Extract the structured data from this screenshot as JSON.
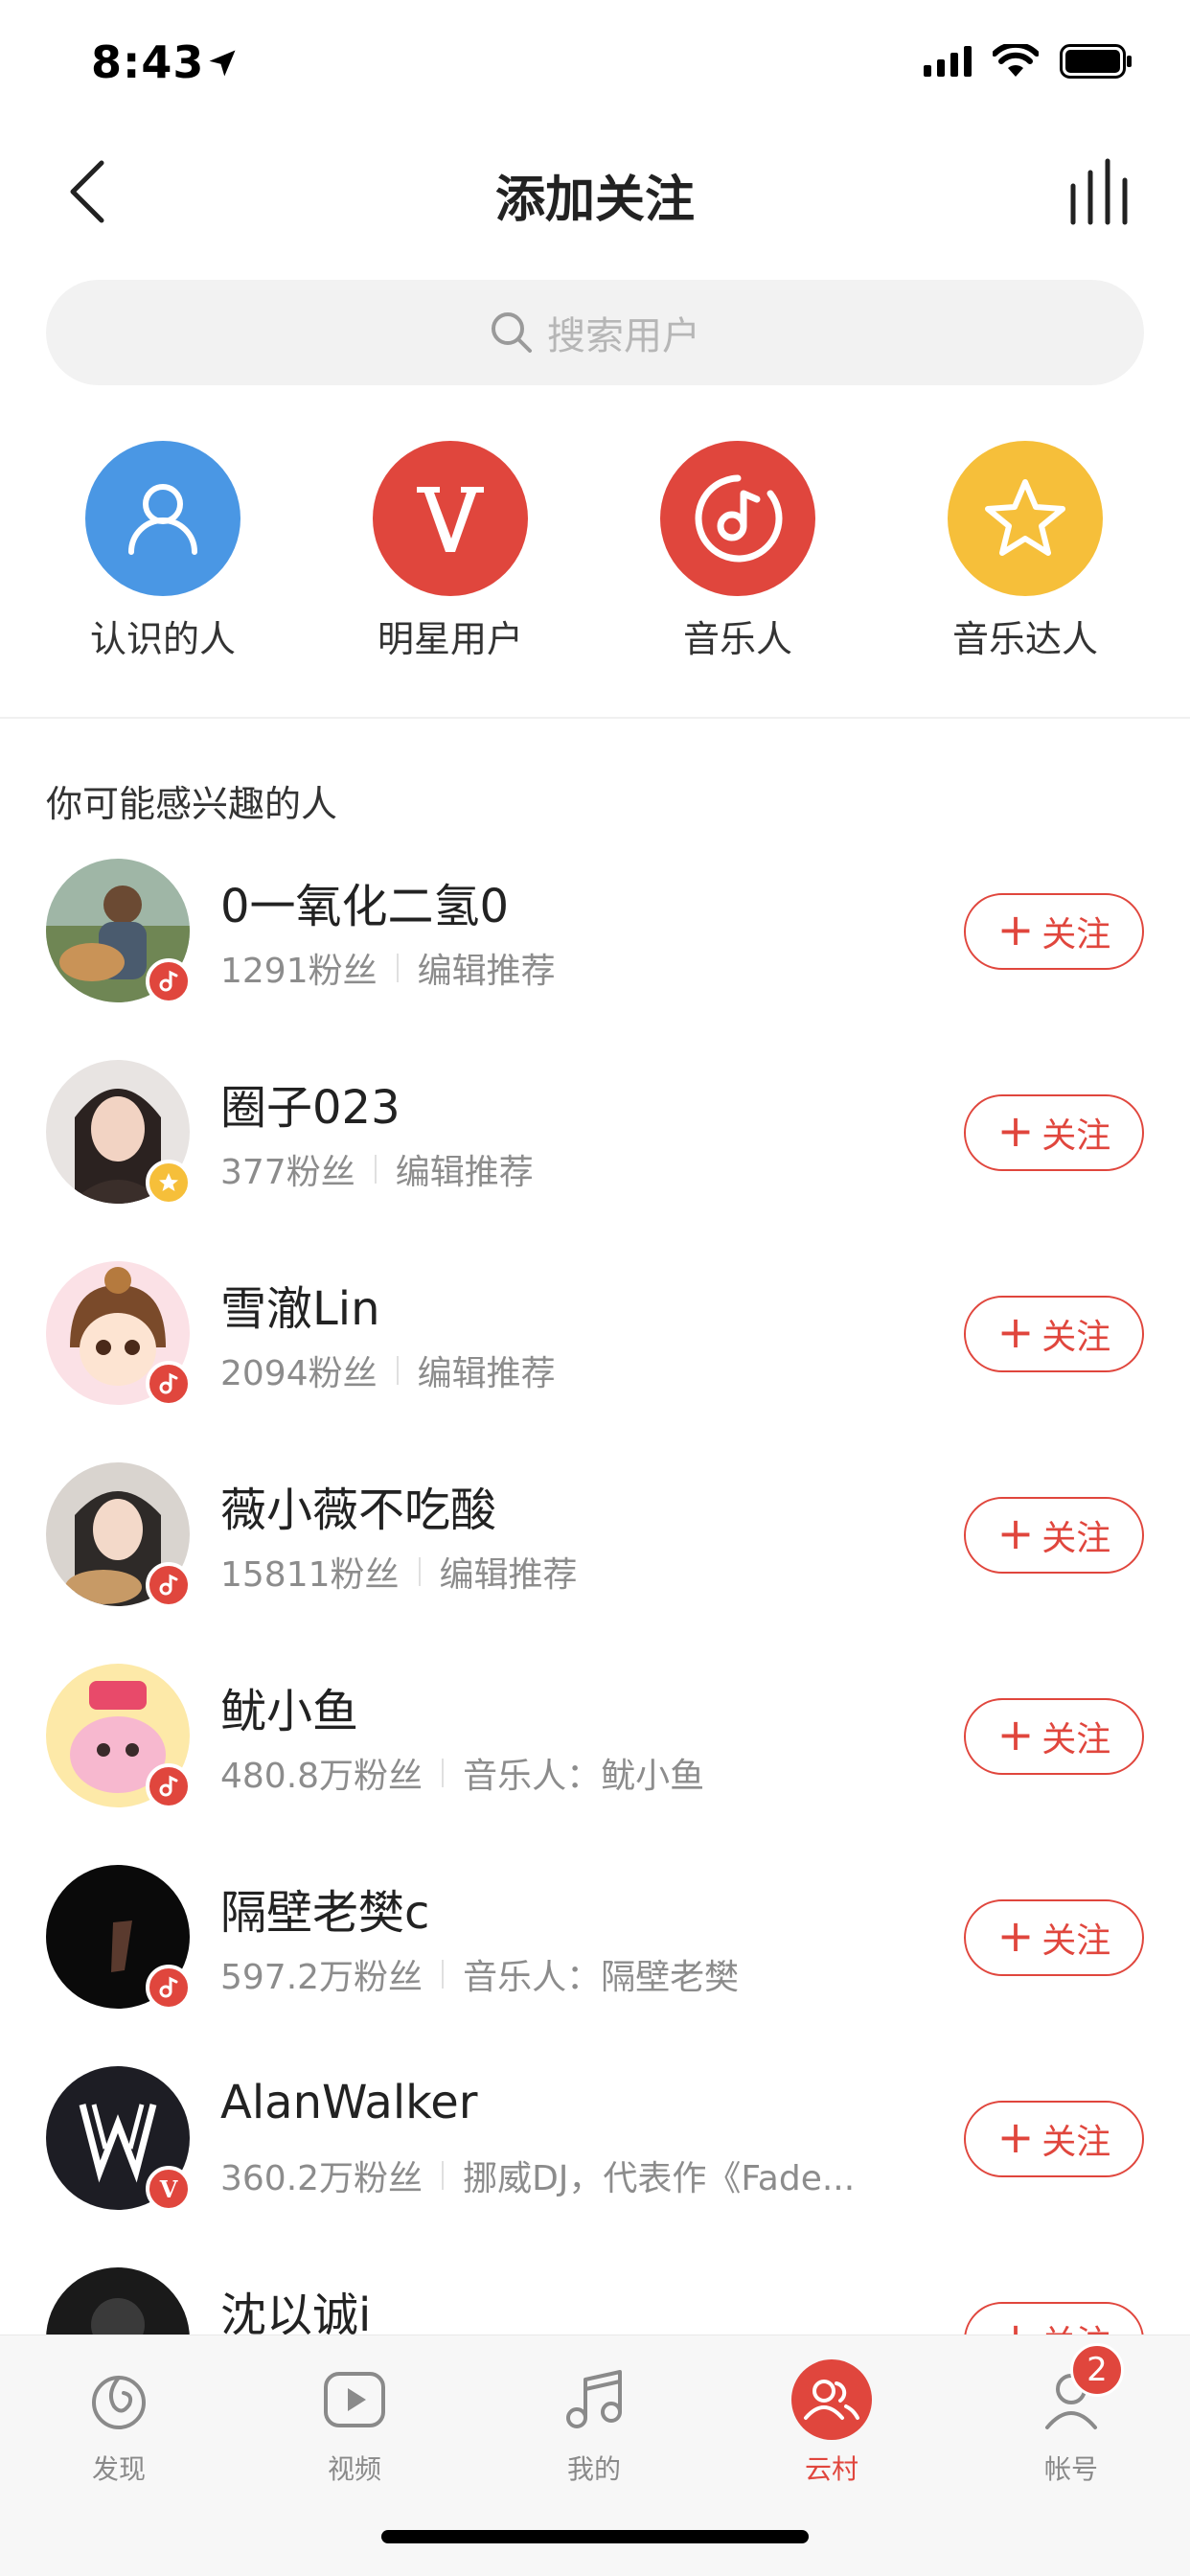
{
  "status_bar": {
    "time": "8:43"
  },
  "header": {
    "title": "添加关注"
  },
  "search": {
    "placeholder": "搜索用户"
  },
  "categories": [
    {
      "label": "认识的人",
      "color": "#4a97e4",
      "icon": "person-icon"
    },
    {
      "label": "明星用户",
      "color": "#e0463d",
      "icon": "v-icon"
    },
    {
      "label": "音乐人",
      "color": "#e0463d",
      "icon": "music-note-icon"
    },
    {
      "label": "音乐达人",
      "color": "#f6bf3a",
      "icon": "star-icon"
    }
  ],
  "section_title": "你可能感兴趣的人",
  "follow_label": "关注",
  "users": [
    {
      "name": "0一氧化二氢0",
      "fans": "1291粉丝",
      "desc": "编辑推荐",
      "badge": "music"
    },
    {
      "name": "圈子023",
      "fans": "377粉丝",
      "desc": "编辑推荐",
      "badge": "star"
    },
    {
      "name": "雪澈Lin",
      "fans": "2094粉丝",
      "desc": "编辑推荐",
      "badge": "music"
    },
    {
      "name": "薇小薇不吃酸",
      "fans": "15811粉丝",
      "desc": "编辑推荐",
      "badge": "music"
    },
    {
      "name": "鱿小鱼",
      "fans": "480.8万粉丝",
      "desc": "音乐人：鱿小鱼",
      "badge": "music"
    },
    {
      "name": "隔壁老樊c",
      "fans": "597.2万粉丝",
      "desc": "音乐人：隔壁老樊",
      "badge": "music"
    },
    {
      "name": "AlanWalker",
      "fans": "360.2万粉丝",
      "desc": "挪威DJ，代表作《Fade...",
      "badge": "v"
    },
    {
      "name": "沈以诚i",
      "fans": "",
      "desc": "",
      "badge": ""
    }
  ],
  "avatar_badge_v": "V",
  "tabs": [
    {
      "label": "发现",
      "icon": "discover-icon"
    },
    {
      "label": "视频",
      "icon": "video-icon"
    },
    {
      "label": "我的",
      "icon": "music-icon"
    },
    {
      "label": "云村",
      "icon": "community-icon",
      "active": true
    },
    {
      "label": "帐号",
      "icon": "account-icon",
      "badge": "2"
    }
  ],
  "colors": {
    "accent": "#e0463d",
    "blue": "#4a97e4",
    "yellow": "#f6bf3a"
  }
}
